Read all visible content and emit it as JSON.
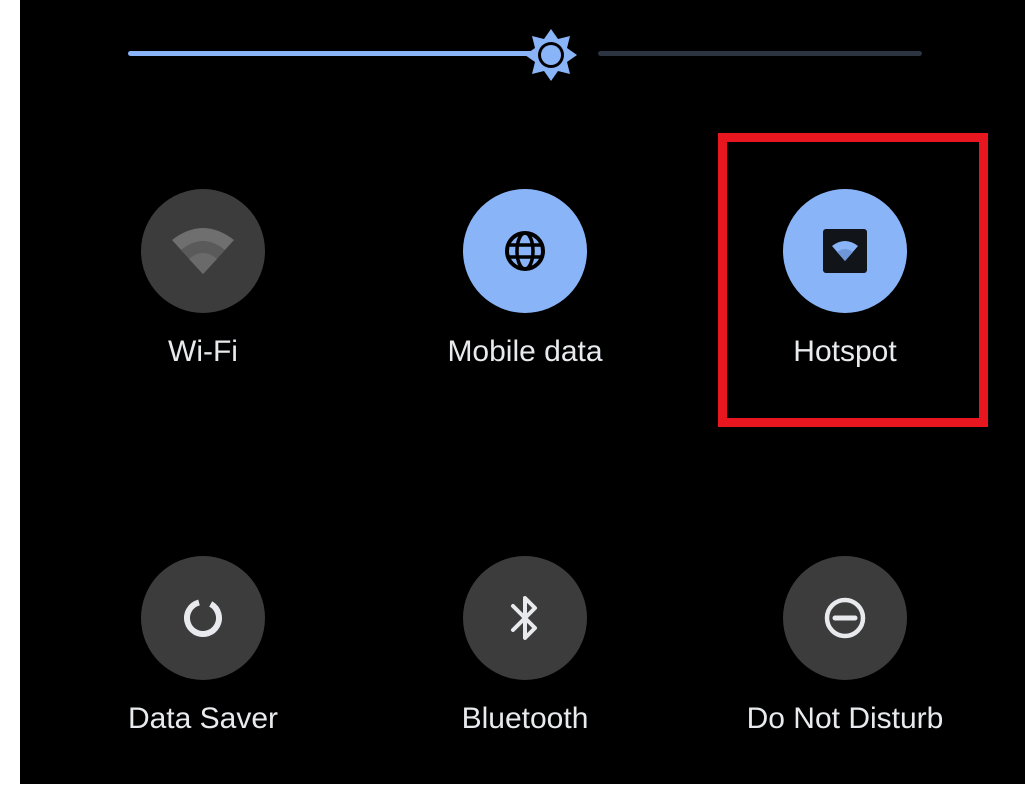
{
  "quick_settings": {
    "brightness": {
      "level": 0.53,
      "icon": "brightness-icon"
    },
    "tiles": [
      {
        "label": "Wi-Fi",
        "state": "off",
        "icon": "wifi-icon"
      },
      {
        "label": "Mobile data",
        "state": "on",
        "icon": "globe-icon"
      },
      {
        "label": "Hotspot",
        "state": "on",
        "icon": "hotspot-icon",
        "highlighted": true
      },
      {
        "label": "Data Saver",
        "state": "off",
        "icon": "data-saver-icon"
      },
      {
        "label": "Bluetooth",
        "state": "off",
        "icon": "bluetooth-icon"
      },
      {
        "label": "Do Not Disturb",
        "state": "off",
        "icon": "do-not-disturb-icon"
      }
    ]
  },
  "colors": {
    "background": "#000000",
    "accent": "#8ab4f8",
    "tile_off": "#3c3c3c",
    "highlight": "#e8161e",
    "label": "#e8eaed"
  }
}
